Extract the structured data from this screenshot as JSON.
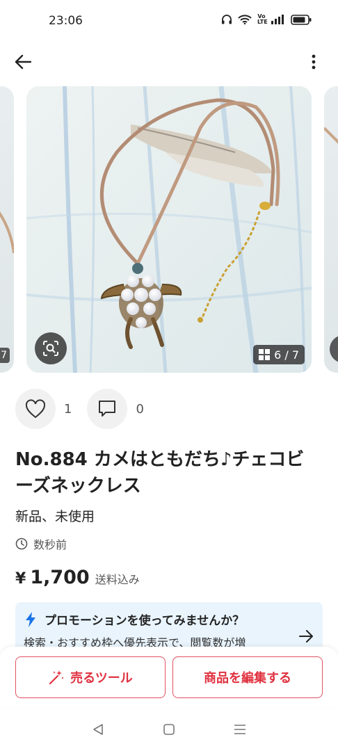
{
  "status_bar": {
    "time": "23:06",
    "volte_label": "Vo\nLTE",
    "icons": [
      "headphones-icon",
      "wifi-icon",
      "volte-icon",
      "signal-icon",
      "battery-icon"
    ]
  },
  "app_bar": {
    "back_icon": "arrow-left-icon",
    "more_icon": "more-vertical-icon"
  },
  "gallery": {
    "current_index": "6 / 7",
    "left_peek_counter": "7",
    "lens_icon": "image-search-icon",
    "counter_icon": "grid-icon"
  },
  "reactions": {
    "like_icon": "heart-icon",
    "like_count": "1",
    "comment_icon": "comment-icon",
    "comment_count": "0"
  },
  "item": {
    "title": "No.884 カメはともだち♪チェコビーズネックレス",
    "condition": "新品、未使用",
    "posted_time": "数秒前",
    "currency": "¥",
    "price": "1,700",
    "shipping_note": "送料込み"
  },
  "promotion": {
    "heading": "プロモーションを使ってみませんか？",
    "body": "検索・おすすめ枠へ優先表示で、閲覧数が増",
    "accent_color": "#1a73e8"
  },
  "actions": {
    "sell_tools_label": "売るツール",
    "edit_item_label": "商品を編集する",
    "accent_color": "#e0313f"
  },
  "nav_bar": {
    "back": "nav-back-icon",
    "home": "nav-home-icon",
    "recents": "nav-recents-icon"
  }
}
